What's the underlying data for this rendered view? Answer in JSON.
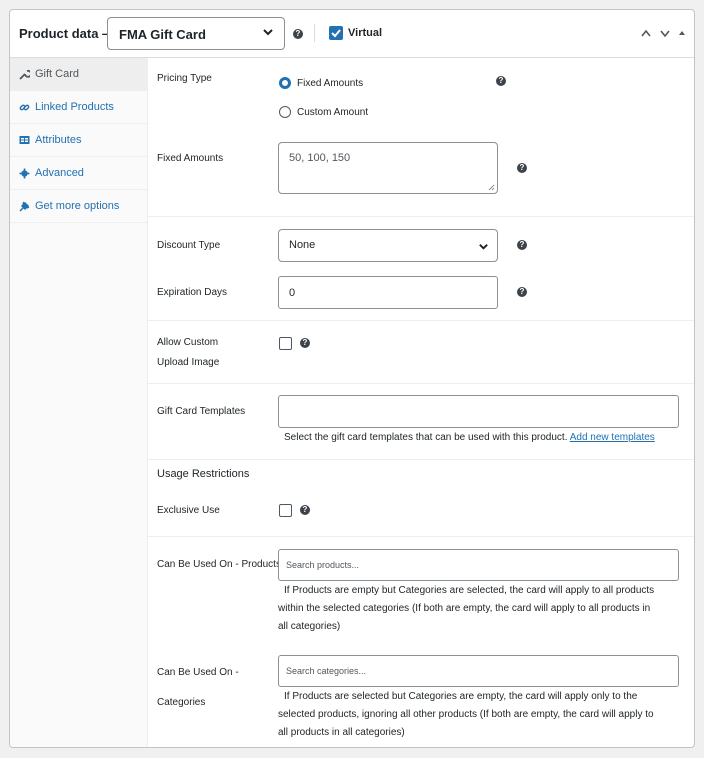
{
  "header": {
    "title": "Product data —",
    "product_type": "FMA Gift Card",
    "virtual_label": "Virtual",
    "virtual_checked": true
  },
  "sidebar": {
    "items": [
      {
        "label": "Gift Card",
        "icon": "wrench-icon",
        "active": true
      },
      {
        "label": "Linked Products",
        "icon": "link-icon",
        "active": false
      },
      {
        "label": "Attributes",
        "icon": "table-icon",
        "active": false
      },
      {
        "label": "Advanced",
        "icon": "gear-icon",
        "active": false
      },
      {
        "label": "Get more options",
        "icon": "plugin-icon",
        "active": false
      }
    ]
  },
  "form": {
    "pricing_type_label": "Pricing Type",
    "pricing_options": [
      "Fixed Amounts",
      "Custom Amount"
    ],
    "pricing_selected": "Fixed Amounts",
    "fixed_amounts_label": "Fixed Amounts",
    "fixed_amounts_value": "50, 100, 150",
    "discount_type_label": "Discount Type",
    "discount_type_value": "None",
    "expiration_days_label": "Expiration Days",
    "expiration_days_value": "0",
    "allow_upload_label_1": "Allow Custom",
    "allow_upload_label_2": "Upload Image",
    "templates_label": "Gift Card Templates",
    "templates_desc": "Select the gift card templates that can be used with this product.",
    "templates_link": "Add new templates",
    "usage_title": "Usage Restrictions",
    "exclusive_label": "Exclusive Use",
    "products_label": "Can Be Used On - Products",
    "products_placeholder": "Search products...",
    "products_desc_1": "If Products are empty but Categories are selected, the card will apply to all products",
    "products_desc_2": "within the selected categories (If both are empty, the card will apply to all products in",
    "products_desc_3": "all categories)",
    "categories_label_1": "Can Be Used On -",
    "categories_label_2": "Categories",
    "categories_placeholder": "Search categories...",
    "categories_desc_1": "If Products are selected but Categories are empty, the card will apply only to the",
    "categories_desc_2": "selected products, ignoring all other products (If both are empty, the card will apply to",
    "categories_desc_3": "all products in all categories)"
  },
  "colors": {
    "accent": "#2271b1",
    "border": "#8c8f94",
    "background": "#f0f0f1"
  }
}
